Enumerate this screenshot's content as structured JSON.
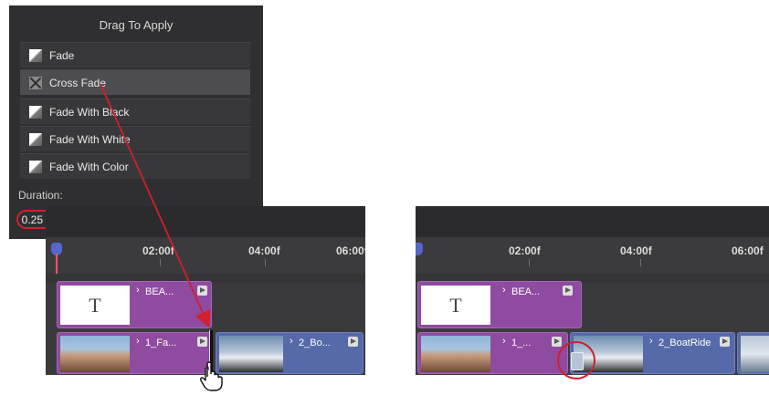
{
  "panel": {
    "title": "Drag To Apply",
    "transitions": [
      {
        "label": "Fade",
        "icon": "fade-icon",
        "selected": false
      },
      {
        "label": "Cross Fade",
        "icon": "cross-fade-icon",
        "selected": true
      },
      {
        "label": "Fade With Black",
        "icon": "fade-icon",
        "selected": false
      },
      {
        "label": "Fade With White",
        "icon": "fade-icon",
        "selected": false
      },
      {
        "label": "Fade With Color",
        "icon": "fade-icon",
        "selected": false
      }
    ],
    "duration_label": "Duration:",
    "duration_value": "0.25 s",
    "duration_chevron": "chevron-down-icon"
  },
  "timeline_before": {
    "ticks": [
      "02:00f",
      "04:00f",
      "06:00f"
    ],
    "title_clip": {
      "thumb": "T",
      "name": "BEA..."
    },
    "clip1": {
      "name": "1_Fa..."
    },
    "clip2": {
      "name": "2_Bo..."
    }
  },
  "timeline_after": {
    "ticks": [
      "02:00f",
      "04:00f",
      "06:00f"
    ],
    "title_clip": {
      "thumb": "T",
      "name": "BEA..."
    },
    "clip1": {
      "name": "1_..."
    },
    "clip2": {
      "name": "2_BoatRide"
    }
  },
  "colors": {
    "panel_bg": "#2f2f31",
    "title_clip": "#8f4b9f",
    "video_clip": "#5669a8",
    "annotation": "#d0202e"
  }
}
